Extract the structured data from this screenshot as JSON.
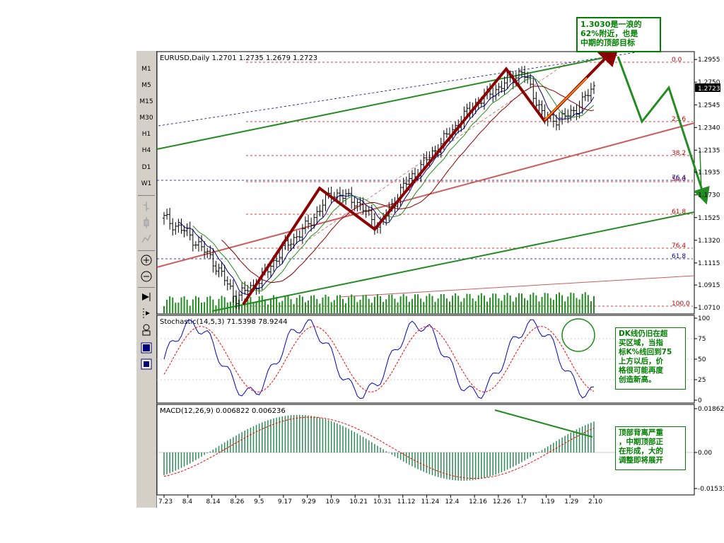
{
  "timeframes": [
    "M1",
    "M5",
    "M15",
    "M30",
    "H1",
    "H4",
    "D1",
    "W1"
  ],
  "main_header": "EURUSD,Daily  1.2701 1.2735 1.2679 1.2723",
  "stoch_header": "Stochastic(14,5,3)  71.5398  78.9244",
  "macd_header": "MACD(12,26,9)  0.006822  0.006236",
  "current_price": "1.2723",
  "price_ticks": [
    "1.2955",
    "1.2750",
    "1.2545",
    "1.2340",
    "1.2135",
    "1.1935",
    "1.1730",
    "1.1525",
    "1.1320",
    "1.1115",
    "1.0915",
    "1.0710"
  ],
  "stoch_ticks": [
    "100",
    "75",
    "50",
    "25",
    "0"
  ],
  "macd_ticks": [
    "0.01862",
    "0.00",
    "-0.01533"
  ],
  "fib_levels_right": [
    {
      "label": "0.0",
      "color": "#c00000"
    },
    {
      "label": "23.6",
      "color": "#c00000"
    },
    {
      "label": "38.2",
      "color": "#c00000"
    },
    {
      "label": "50.0",
      "color": "#c00000"
    },
    {
      "label": "61.8",
      "color": "#c00000"
    },
    {
      "label": "76.4",
      "color": "#c00000"
    },
    {
      "label": "100.0",
      "color": "#c00000"
    }
  ],
  "fib_levels_blue": [
    {
      "label": "76.4",
      "color": "#00008b"
    },
    {
      "label": "61.8",
      "color": "#00008b"
    }
  ],
  "date_labels": [
    "7.23",
    "8.4",
    "8.14",
    "8.26",
    "9.5",
    "9.17",
    "9.29",
    "10.9",
    "10.21",
    "10.31",
    "11.12",
    "11.24",
    "12.4",
    "12.16",
    "12.26",
    "1.7",
    "1.19",
    "1.29",
    "2.10"
  ],
  "annotations": {
    "top": "1.3030是一浪的\n62%附近，也是\n中期的顶部目标",
    "stoch": "DK线仍旧在超\n买区域，当指\n标K%线回到75\n上方以后，价\n格很可能再度\n创造新高。",
    "macd": "顶部背离严重\n，中期顶部正\n在形成，大的\n调整即将展开"
  },
  "colors": {
    "bull_green": "#228b22",
    "zigzag": "#8b0000",
    "channel_red": "#cd5c5c",
    "note_text": "#008000"
  },
  "chart_data": {
    "type": "candlestick",
    "symbol": "EURUSD",
    "timeframe": "Daily",
    "last_ohlc": {
      "open": 1.2701,
      "high": 1.2735,
      "low": 1.2679,
      "close": 1.2723
    },
    "dates": [
      "7.23",
      "8.4",
      "8.14",
      "8.26",
      "9.5",
      "9.17",
      "9.29",
      "10.9",
      "10.21",
      "10.31",
      "11.12",
      "11.24",
      "12.4",
      "12.16",
      "12.26",
      "1.7",
      "1.19",
      "1.29",
      "2.10"
    ],
    "close_approx": [
      1.152,
      1.138,
      1.115,
      1.08,
      1.095,
      1.125,
      1.145,
      1.175,
      1.168,
      1.144,
      1.18,
      1.205,
      1.23,
      1.255,
      1.27,
      1.285,
      1.24,
      1.245,
      1.27
    ],
    "zigzag": [
      {
        "date": "8.31",
        "price": 1.074
      },
      {
        "date": "10.9",
        "price": 1.179
      },
      {
        "date": "10.31",
        "price": 1.142
      },
      {
        "date": "1.7",
        "price": 1.287
      },
      {
        "date": "1.29",
        "price": 1.24
      },
      {
        "date": "2.20",
        "price": 1.303
      }
    ],
    "stochastic": {
      "k": 71.5398,
      "d": 78.9244,
      "range": [
        0,
        100
      ]
    },
    "macd": {
      "main": 0.006822,
      "signal": 0.006236,
      "range": [
        -0.01533,
        0.01862
      ]
    },
    "fibonacci": [
      "0.0",
      "23.6",
      "38.2",
      "50.0",
      "61.8",
      "76.4",
      "100.0"
    ]
  }
}
